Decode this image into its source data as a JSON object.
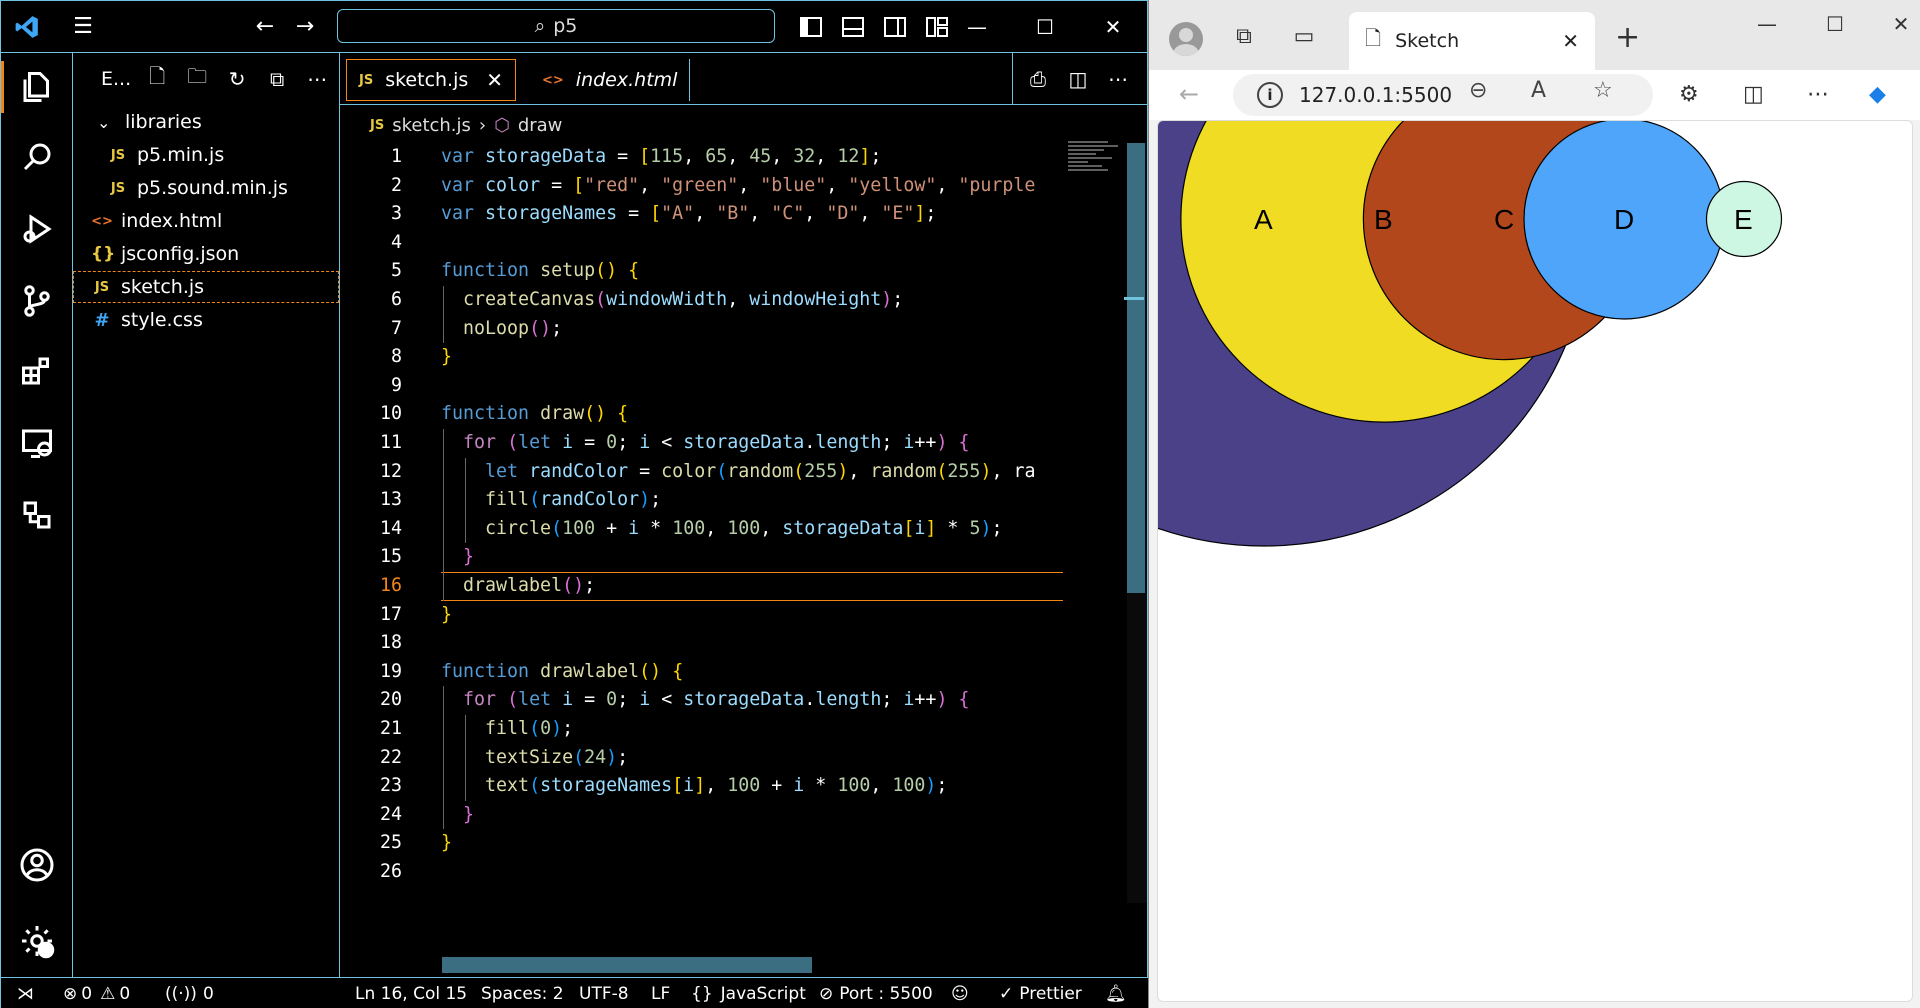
{
  "vscode": {
    "search": "p5",
    "sidebar": {
      "title": "E...",
      "items": [
        {
          "label": "libraries",
          "type": "folder"
        },
        {
          "label": "p5.min.js",
          "type": "js"
        },
        {
          "label": "p5.sound.min.js",
          "type": "js"
        },
        {
          "label": "index.html",
          "type": "html"
        },
        {
          "label": "jsconfig.json",
          "type": "json"
        },
        {
          "label": "sketch.js",
          "type": "js"
        },
        {
          "label": "style.css",
          "type": "css"
        }
      ]
    },
    "tabs": [
      {
        "label": "sketch.js",
        "icon": "JS"
      },
      {
        "label": "index.html",
        "icon": "<>"
      }
    ],
    "breadcrumb": {
      "file": "sketch.js",
      "symbol": "draw"
    },
    "code_lines": [
      "var storageData = [115, 65, 45, 32, 12];",
      "var color = [\"red\", \"green\", \"blue\", \"yellow\", \"purple",
      "var storageNames = [\"A\", \"B\", \"C\", \"D\", \"E\"];",
      "",
      "function setup() {",
      "  createCanvas(windowWidth, windowHeight);",
      "  noLoop();",
      "}",
      "",
      "function draw() {",
      "  for (let i = 0; i < storageData.length; i++) {",
      "    let randColor = color(random(255), random(255), ra",
      "    fill(randColor);",
      "    circle(100 + i * 100, 100, storageData[i] * 5);",
      "  }",
      "  drawlabel();",
      "}",
      "",
      "function drawlabel() {",
      "  for (let i = 0; i < storageData.length; i++) {",
      "    fill(0);",
      "    textSize(24);",
      "    text(storageNames[i], 100 + i * 100, 100);",
      "  }",
      "}",
      ""
    ],
    "current_line": 16,
    "status": {
      "errors": "0",
      "warnings": "0",
      "ports": "0",
      "position": "Ln 16, Col 15",
      "spaces": "Spaces: 2",
      "encoding": "UTF-8",
      "eol": "LF",
      "language": "JavaScript",
      "port": "Port : 5500",
      "prettier": "Prettier"
    }
  },
  "browser": {
    "tab_title": "Sketch",
    "address": "127.0.0.1:5500",
    "canvas": {
      "labels": [
        "A",
        "B",
        "C",
        "D",
        "E"
      ],
      "circle_colors": [
        "#4a4189",
        "#f0dc23",
        "#b1471b",
        "#4ea5f9",
        "#cdf7e2"
      ]
    }
  }
}
